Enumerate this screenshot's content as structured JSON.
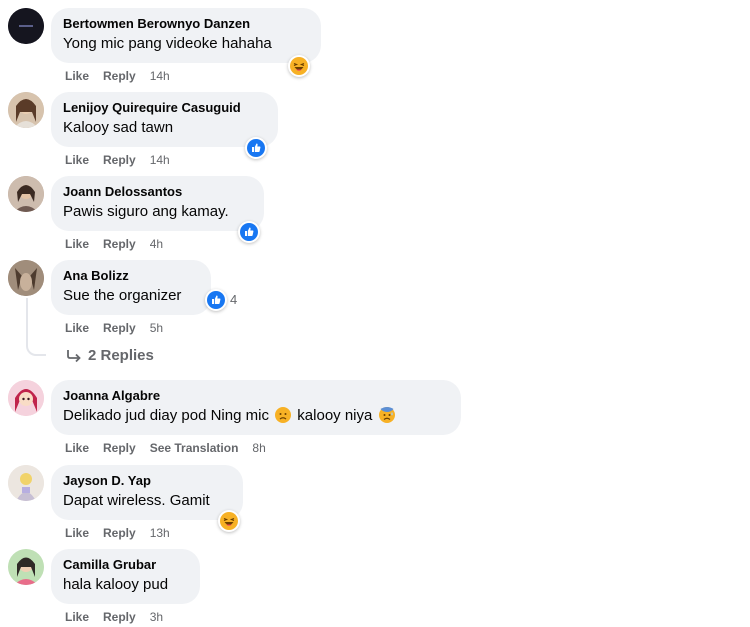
{
  "comments": [
    {
      "author": "Bertowmen Berownyo Danzen",
      "text": "Yong mic pang videoke hahaha",
      "like": "Like",
      "reply": "Reply",
      "time": "14h",
      "reaction_icon": "haha-emoji-icon"
    },
    {
      "author": "Lenijoy Quirequire Casuguid",
      "text": "Kalooy sad tawn",
      "like": "Like",
      "reply": "Reply",
      "time": "14h",
      "reaction_icon": "like-reaction-icon"
    },
    {
      "author": "Joann Delossantos",
      "text": "Pawis siguro ang kamay.",
      "like": "Like",
      "reply": "Reply",
      "time": "4h",
      "reaction_icon": "like-reaction-icon"
    },
    {
      "author": "Ana Bolizz",
      "text": "Sue the organizer",
      "like": "Like",
      "reply": "Reply",
      "time": "5h",
      "reaction_icon": "like-reaction-icon",
      "reaction_count": "4",
      "replies_label": "2 Replies"
    },
    {
      "author": "Joanna Algabre",
      "text_before": "Delikado jud diay pod Ning mic",
      "text_middle": "kalooy niya",
      "like": "Like",
      "reply": "Reply",
      "see_translation": "See Translation",
      "time": "8h"
    },
    {
      "author": "Jayson D. Yap",
      "text": "Dapat wireless. Gamit",
      "like": "Like",
      "reply": "Reply",
      "time": "13h",
      "reaction_icon": "haha-emoji-icon"
    },
    {
      "author": "Camilla Grubar",
      "text": "hala kalooy pud",
      "like": "Like",
      "reply": "Reply",
      "time": "3h"
    }
  ],
  "colors": {
    "bubble": "#f0f2f5",
    "secondary_text": "#65676b",
    "like_blue": "#1877f2"
  }
}
